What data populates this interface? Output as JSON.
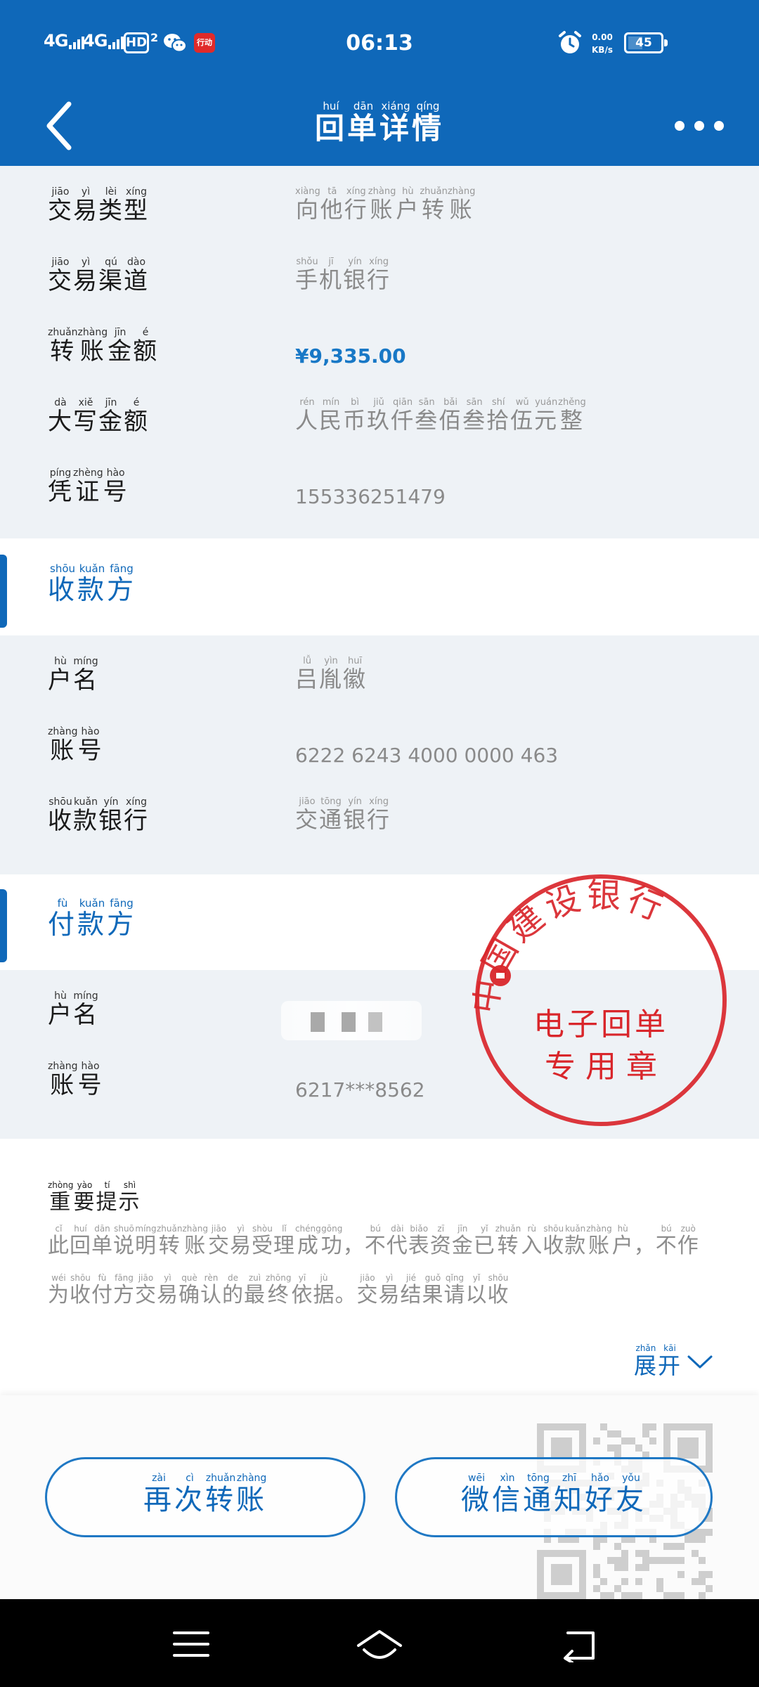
{
  "status_bar": {
    "signal1": "4G",
    "signal2": "4G",
    "hd": "HD",
    "hd_sim": "2",
    "time": "06:13",
    "net_speed_value": "0.00",
    "net_speed_unit": "KB/s",
    "battery": "45",
    "battery_level_percent": 45,
    "red_app_label": "行动"
  },
  "header": {
    "title": [
      {
        "c": "回",
        "p": "huí"
      },
      {
        "c": "单",
        "p": "dān"
      },
      {
        "c": "详",
        "p": "xiáng"
      },
      {
        "c": "情",
        "p": "qíng"
      }
    ]
  },
  "transaction": {
    "rows": [
      {
        "label": [
          {
            "c": "交",
            "p": "jiāo"
          },
          {
            "c": "易",
            "p": "yì"
          },
          {
            "c": "类",
            "p": "lèi"
          },
          {
            "c": "型",
            "p": "xíng"
          }
        ],
        "value": [
          {
            "c": "向",
            "p": "xiàng"
          },
          {
            "c": "他",
            "p": "tā"
          },
          {
            "c": "行",
            "p": "xíng"
          },
          {
            "c": "账",
            "p": "zhàng"
          },
          {
            "c": "户",
            "p": "hù"
          },
          {
            "c": "转",
            "p": "zhuǎn"
          },
          {
            "c": "账",
            "p": "zhàng"
          }
        ]
      },
      {
        "label": [
          {
            "c": "交",
            "p": "jiāo"
          },
          {
            "c": "易",
            "p": "yì"
          },
          {
            "c": "渠",
            "p": "qú"
          },
          {
            "c": "道",
            "p": "dào"
          }
        ],
        "value": [
          {
            "c": "手",
            "p": "shǒu"
          },
          {
            "c": "机",
            "p": "jī"
          },
          {
            "c": "银",
            "p": "yín"
          },
          {
            "c": "行",
            "p": "xíng"
          }
        ]
      },
      {
        "label": [
          {
            "c": "转",
            "p": "zhuǎn"
          },
          {
            "c": "账",
            "p": "zhàng"
          },
          {
            "c": "金",
            "p": "jīn"
          },
          {
            "c": "额",
            "p": "é"
          }
        ],
        "value_text": "¥9,335.00"
      },
      {
        "label": [
          {
            "c": "大",
            "p": "dà"
          },
          {
            "c": "写",
            "p": "xiě"
          },
          {
            "c": "金",
            "p": "jīn"
          },
          {
            "c": "额",
            "p": "é"
          }
        ],
        "value": [
          {
            "c": "人",
            "p": "rén"
          },
          {
            "c": "民",
            "p": "mín"
          },
          {
            "c": "币",
            "p": "bì"
          },
          {
            "c": "玖",
            "p": "jiǔ"
          },
          {
            "c": "仟",
            "p": "qiān"
          },
          {
            "c": "叁",
            "p": "sān"
          },
          {
            "c": "佰",
            "p": "bǎi"
          },
          {
            "c": "叁",
            "p": "sān"
          },
          {
            "c": "拾",
            "p": "shí"
          },
          {
            "c": "伍",
            "p": "wǔ"
          },
          {
            "c": "元",
            "p": "yuán"
          },
          {
            "c": "整",
            "p": "zhěng"
          }
        ]
      },
      {
        "label": [
          {
            "c": "凭",
            "p": "píng"
          },
          {
            "c": "证",
            "p": "zhèng"
          },
          {
            "c": "号",
            "p": "hào"
          }
        ],
        "value_text": "155336251479"
      }
    ]
  },
  "payee": {
    "title": [
      {
        "c": "收",
        "p": "shōu"
      },
      {
        "c": "款",
        "p": "kuǎn"
      },
      {
        "c": "方",
        "p": "fāng"
      }
    ],
    "rows": [
      {
        "label": [
          {
            "c": "户",
            "p": "hù"
          },
          {
            "c": "名",
            "p": "míng"
          }
        ],
        "value": [
          {
            "c": "吕",
            "p": "lǚ"
          },
          {
            "c": "胤",
            "p": "yìn"
          },
          {
            "c": "徽",
            "p": "huī"
          }
        ]
      },
      {
        "label": [
          {
            "c": "账",
            "p": "zhàng"
          },
          {
            "c": "号",
            "p": "hào"
          }
        ],
        "value_text": "6222 6243 4000 0000 463"
      },
      {
        "label": [
          {
            "c": "收",
            "p": "shōu"
          },
          {
            "c": "款",
            "p": "kuǎn"
          },
          {
            "c": "银",
            "p": "yín"
          },
          {
            "c": "行",
            "p": "xíng"
          }
        ],
        "value": [
          {
            "c": "交",
            "p": "jiāo"
          },
          {
            "c": "通",
            "p": "tōng"
          },
          {
            "c": "银",
            "p": "yín"
          },
          {
            "c": "行",
            "p": "xíng"
          }
        ]
      }
    ]
  },
  "payer": {
    "title": [
      {
        "c": "付",
        "p": "fù"
      },
      {
        "c": "款",
        "p": "kuǎn"
      },
      {
        "c": "方",
        "p": "fāng"
      }
    ],
    "rows": [
      {
        "label": [
          {
            "c": "户",
            "p": "hù"
          },
          {
            "c": "名",
            "p": "míng"
          }
        ],
        "masked": true
      },
      {
        "label": [
          {
            "c": "账",
            "p": "zhàng"
          },
          {
            "c": "号",
            "p": "hào"
          }
        ],
        "value_text": "6217***8562"
      }
    ]
  },
  "stamp": {
    "ring_text": "中国建设银行",
    "line1": "电子回单",
    "line2": "专 用 章",
    "color": "#d9262b"
  },
  "notice": {
    "title": [
      {
        "c": "重",
        "p": "zhòng"
      },
      {
        "c": "要",
        "p": "yào"
      },
      {
        "c": "提",
        "p": "tí"
      },
      {
        "c": "示",
        "p": "shì"
      }
    ],
    "text": [
      {
        "c": "此",
        "p": "cǐ"
      },
      {
        "c": "回",
        "p": "huí"
      },
      {
        "c": "单",
        "p": "dān"
      },
      {
        "c": "说",
        "p": "shuō"
      },
      {
        "c": "明",
        "p": "míng"
      },
      {
        "c": "转",
        "p": "zhuǎn"
      },
      {
        "c": "账",
        "p": "zhàng"
      },
      {
        "c": "交",
        "p": "jiāo"
      },
      {
        "c": "易",
        "p": "yì"
      },
      {
        "c": "受",
        "p": "shòu"
      },
      {
        "c": "理",
        "p": "lǐ"
      },
      {
        "c": "成",
        "p": "chéng"
      },
      {
        "c": "功",
        "p": "gōng"
      },
      {
        "c": "，",
        "p": ""
      },
      {
        "c": "不",
        "p": "bú"
      },
      {
        "c": "代",
        "p": "dài"
      },
      {
        "c": "表",
        "p": "biǎo"
      },
      {
        "c": "资",
        "p": "zī"
      },
      {
        "c": "金",
        "p": "jīn"
      },
      {
        "c": "已",
        "p": "yǐ"
      },
      {
        "c": "转",
        "p": "zhuǎn"
      },
      {
        "c": "入",
        "p": "rù"
      },
      {
        "c": "收",
        "p": "shōu"
      },
      {
        "c": "款",
        "p": "kuǎn"
      },
      {
        "c": "账",
        "p": "zhàng"
      },
      {
        "c": "户",
        "p": "hù"
      },
      {
        "c": "，",
        "p": ""
      },
      {
        "c": "不",
        "p": "bú"
      },
      {
        "c": "作",
        "p": "zuò"
      },
      {
        "c": "为",
        "p": "wéi"
      },
      {
        "c": "收",
        "p": "shōu"
      },
      {
        "c": "付",
        "p": "fù"
      },
      {
        "c": "方",
        "p": "fāng"
      },
      {
        "c": "交",
        "p": "jiāo"
      },
      {
        "c": "易",
        "p": "yì"
      },
      {
        "c": "确",
        "p": "què"
      },
      {
        "c": "认",
        "p": "rèn"
      },
      {
        "c": "的",
        "p": "de"
      },
      {
        "c": "最",
        "p": "zuì"
      },
      {
        "c": "终",
        "p": "zhōng"
      },
      {
        "c": "依",
        "p": "yī"
      },
      {
        "c": "据",
        "p": "jù"
      },
      {
        "c": "。",
        "p": ""
      },
      {
        "c": "交",
        "p": "jiāo"
      },
      {
        "c": "易",
        "p": "yì"
      },
      {
        "c": "结",
        "p": "jié"
      },
      {
        "c": "果",
        "p": "guǒ"
      },
      {
        "c": "请",
        "p": "qǐng"
      },
      {
        "c": "以",
        "p": "yǐ"
      },
      {
        "c": "收",
        "p": "shōu"
      }
    ],
    "expand": [
      {
        "c": "展",
        "p": "zhǎn"
      },
      {
        "c": "开",
        "p": "kāi"
      }
    ]
  },
  "buttons": {
    "again": [
      {
        "c": "再",
        "p": "zài"
      },
      {
        "c": "次",
        "p": "cì"
      },
      {
        "c": "转",
        "p": "zhuǎn"
      },
      {
        "c": "账",
        "p": "zhàng"
      }
    ],
    "wechat": [
      {
        "c": "微",
        "p": "wēi"
      },
      {
        "c": "信",
        "p": "xìn"
      },
      {
        "c": "通",
        "p": "tōng"
      },
      {
        "c": "知",
        "p": "zhī"
      },
      {
        "c": "好",
        "p": "hǎo"
      },
      {
        "c": "友",
        "p": "yǒu"
      }
    ]
  },
  "icons": {
    "back": "back-arrow-icon",
    "more": "more-icon",
    "expand": "chevron-down-icon",
    "nav_menu": "menu-icon",
    "nav_home": "home-icon",
    "nav_back": "back-icon"
  }
}
